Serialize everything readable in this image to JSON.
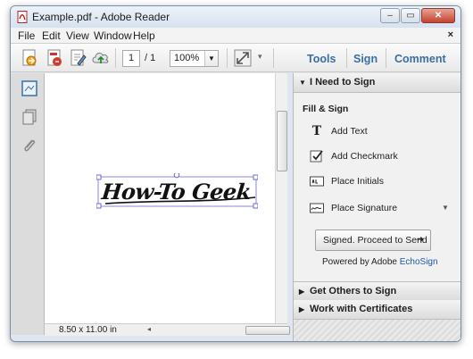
{
  "window": {
    "title": "Example.pdf - Adobe Reader",
    "controls": {
      "minimize": "–",
      "maximize": "▭",
      "close": "✕"
    }
  },
  "menu": {
    "items": [
      "File",
      "Edit",
      "View",
      "Window",
      "Help"
    ],
    "close_glyph": "×"
  },
  "toolbar": {
    "page_current": "1",
    "page_total": "/ 1",
    "zoom": "100%",
    "tabs": [
      "Tools",
      "Sign",
      "Comment"
    ]
  },
  "document": {
    "signature_text": "How-To Geek",
    "page_size": "8.50 x 11.00 in"
  },
  "panel": {
    "need_to_sign": {
      "header": "I Need to Sign",
      "fill_sign_label": "Fill & Sign",
      "items": [
        {
          "label": "Add Text",
          "icon": "text-icon"
        },
        {
          "label": "Add Checkmark",
          "icon": "checkmark-icon"
        },
        {
          "label": "Place Initials",
          "icon": "initials-icon"
        },
        {
          "label": "Place Signature",
          "icon": "signature-icon"
        }
      ],
      "send_button": "Signed. Proceed to Send",
      "powered_by": "Powered by Adobe",
      "echosign": "EchoSign"
    },
    "others": "Get Others to Sign",
    "certificates": "Work with Certificates"
  },
  "colors": {
    "accent": "#3a6ea5",
    "link": "#1d58a8",
    "close_button": "#c4432e"
  }
}
